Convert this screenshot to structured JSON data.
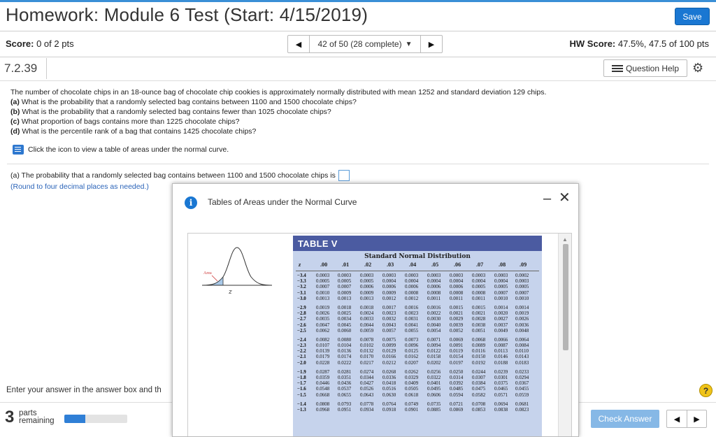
{
  "header": {
    "title": "Homework: Module 6 Test (Start: 4/15/2019)",
    "save_label": "Save"
  },
  "score": {
    "label": "Score:",
    "value": "0 of 2 pts"
  },
  "nav": {
    "prev_icon": "triangle-left-icon",
    "label": "42 of 50 (28 complete)",
    "caret": "▼",
    "next_icon": "triangle-right-icon"
  },
  "hw_score": {
    "label": "HW Score:",
    "value": "47.5%, 47.5 of 100 pts"
  },
  "question": {
    "number": "7.2.39",
    "help_label": "Question Help"
  },
  "problem": {
    "intro": "The number of chocolate chips in an 18-ounce bag of chocolate chip cookies is approximately normally distributed with mean 1252 and standard deviation 129 chips.",
    "parts": [
      {
        "tag": "(a)",
        "text": "What is the probability that a randomly selected bag contains between 1100 and 1500 chocolate chips?"
      },
      {
        "tag": "(b)",
        "text": "What is the probability that a randomly selected bag contains fewer than 1025 chocolate chips?"
      },
      {
        "tag": "(c)",
        "text": "What proportion of bags contains more than 1225 chocolate chips?"
      },
      {
        "tag": "(d)",
        "text": "What is the percentile rank of a bag that contains 1425 chocolate chips?"
      }
    ],
    "icon_note": "Click the icon to view a table of areas under the normal curve."
  },
  "answer": {
    "part_a": "(a) The probability that a randomly selected bag contains between 1100 and 1500 chocolate chips is",
    "round_note": "(Round to four decimal places as needed.)"
  },
  "footer": {
    "enter_answer": "Enter your answer in the answer box and th",
    "help_glyph": "?",
    "parts_count": "3",
    "parts_line1": "parts",
    "parts_line2": "remaining",
    "progress_fraction": 0.33,
    "check_label": "Check Answer"
  },
  "modal": {
    "title": "Tables of Areas under the Normal Curve",
    "info_glyph": "i",
    "min_glyph": "–",
    "close_glyph": "✕",
    "table": {
      "name": "TABLE V",
      "subtitle": "Standard Normal Distribution",
      "area_label": "Area",
      "z_label": "z",
      "columns": [
        "z",
        ".00",
        ".01",
        ".02",
        ".03",
        ".04",
        ".05",
        ".06",
        ".07",
        ".08",
        ".09"
      ],
      "groups": [
        [
          [
            "−3.4",
            "0.0003",
            "0.0003",
            "0.0003",
            "0.0003",
            "0.0003",
            "0.0003",
            "0.0003",
            "0.0003",
            "0.0003",
            "0.0002"
          ],
          [
            "−3.3",
            "0.0005",
            "0.0005",
            "0.0005",
            "0.0004",
            "0.0004",
            "0.0004",
            "0.0004",
            "0.0004",
            "0.0004",
            "0.0003"
          ],
          [
            "−3.2",
            "0.0007",
            "0.0007",
            "0.0006",
            "0.0006",
            "0.0006",
            "0.0006",
            "0.0006",
            "0.0005",
            "0.0005",
            "0.0005"
          ],
          [
            "−3.1",
            "0.0010",
            "0.0009",
            "0.0009",
            "0.0009",
            "0.0008",
            "0.0008",
            "0.0008",
            "0.0008",
            "0.0007",
            "0.0007"
          ],
          [
            "−3.0",
            "0.0013",
            "0.0013",
            "0.0013",
            "0.0012",
            "0.0012",
            "0.0011",
            "0.0011",
            "0.0011",
            "0.0010",
            "0.0010"
          ]
        ],
        [
          [
            "−2.9",
            "0.0019",
            "0.0018",
            "0.0018",
            "0.0017",
            "0.0016",
            "0.0016",
            "0.0015",
            "0.0015",
            "0.0014",
            "0.0014"
          ],
          [
            "−2.8",
            "0.0026",
            "0.0025",
            "0.0024",
            "0.0023",
            "0.0023",
            "0.0022",
            "0.0021",
            "0.0021",
            "0.0020",
            "0.0019"
          ],
          [
            "−2.7",
            "0.0035",
            "0.0034",
            "0.0033",
            "0.0032",
            "0.0031",
            "0.0030",
            "0.0029",
            "0.0028",
            "0.0027",
            "0.0026"
          ],
          [
            "−2.6",
            "0.0047",
            "0.0045",
            "0.0044",
            "0.0043",
            "0.0041",
            "0.0040",
            "0.0039",
            "0.0038",
            "0.0037",
            "0.0036"
          ],
          [
            "−2.5",
            "0.0062",
            "0.0060",
            "0.0059",
            "0.0057",
            "0.0055",
            "0.0054",
            "0.0052",
            "0.0051",
            "0.0049",
            "0.0048"
          ]
        ],
        [
          [
            "−2.4",
            "0.0082",
            "0.0080",
            "0.0078",
            "0.0075",
            "0.0073",
            "0.0071",
            "0.0069",
            "0.0068",
            "0.0066",
            "0.0064"
          ],
          [
            "−2.3",
            "0.0107",
            "0.0104",
            "0.0102",
            "0.0099",
            "0.0096",
            "0.0094",
            "0.0091",
            "0.0089",
            "0.0087",
            "0.0084"
          ],
          [
            "−2.2",
            "0.0139",
            "0.0136",
            "0.0132",
            "0.0129",
            "0.0125",
            "0.0122",
            "0.0119",
            "0.0116",
            "0.0113",
            "0.0110"
          ],
          [
            "−2.1",
            "0.0179",
            "0.0174",
            "0.0170",
            "0.0166",
            "0.0162",
            "0.0158",
            "0.0154",
            "0.0150",
            "0.0146",
            "0.0143"
          ],
          [
            "−2.0",
            "0.0228",
            "0.0222",
            "0.0217",
            "0.0212",
            "0.0207",
            "0.0202",
            "0.0197",
            "0.0192",
            "0.0188",
            "0.0183"
          ]
        ],
        [
          [
            "−1.9",
            "0.0287",
            "0.0281",
            "0.0274",
            "0.0268",
            "0.0262",
            "0.0256",
            "0.0250",
            "0.0244",
            "0.0239",
            "0.0233"
          ],
          [
            "−1.8",
            "0.0359",
            "0.0351",
            "0.0344",
            "0.0336",
            "0.0329",
            "0.0322",
            "0.0314",
            "0.0307",
            "0.0301",
            "0.0294"
          ],
          [
            "−1.7",
            "0.0446",
            "0.0436",
            "0.0427",
            "0.0418",
            "0.0409",
            "0.0401",
            "0.0392",
            "0.0384",
            "0.0375",
            "0.0367"
          ],
          [
            "−1.6",
            "0.0548",
            "0.0537",
            "0.0526",
            "0.0516",
            "0.0505",
            "0.0495",
            "0.0485",
            "0.0475",
            "0.0465",
            "0.0455"
          ],
          [
            "−1.5",
            "0.0668",
            "0.0655",
            "0.0643",
            "0.0630",
            "0.0618",
            "0.0606",
            "0.0594",
            "0.0582",
            "0.0571",
            "0.0559"
          ]
        ],
        [
          [
            "−1.4",
            "0.0808",
            "0.0793",
            "0.0778",
            "0.0764",
            "0.0749",
            "0.0735",
            "0.0721",
            "0.0708",
            "0.0694",
            "0.0681"
          ],
          [
            "−1.3",
            "0.0968",
            "0.0951",
            "0.0934",
            "0.0918",
            "0.0901",
            "0.0885",
            "0.0869",
            "0.0853",
            "0.0838",
            "0.0823"
          ]
        ]
      ]
    }
  },
  "colors": {
    "accent": "#1a77d2",
    "table_header": "#4b5ba1",
    "table_bg": "#c6d3ec",
    "check_button": "#86b8e6"
  }
}
